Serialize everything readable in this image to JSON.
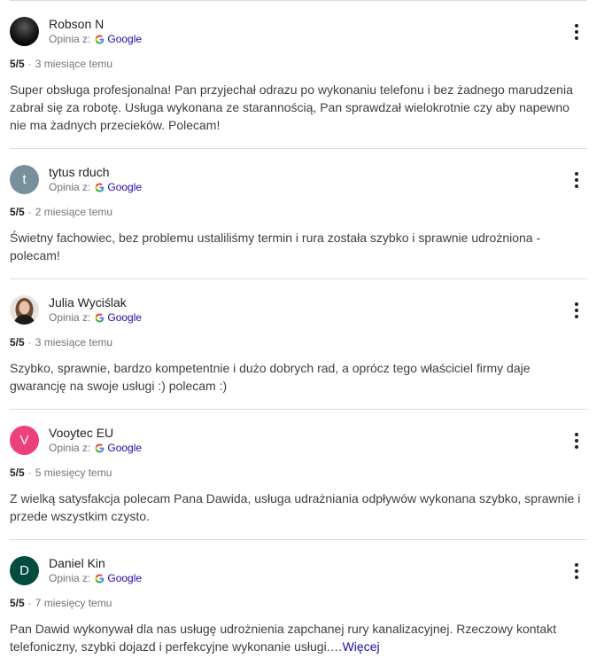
{
  "colors": {
    "google_link": "#1a0dab",
    "meta_gray": "#70757a",
    "divider": "#dadce0"
  },
  "reviews": [
    {
      "author": "Robson N",
      "avatar": {
        "type": "photo",
        "initial": "",
        "color": "#000000"
      },
      "source_prefix": "Opinia z:",
      "source_name": "Google",
      "score": "5/5",
      "separator": "·",
      "date": "3 miesiące temu",
      "text": "Super obsługa profesjonalna! Pan przyjechał odrazu po wykonaniu telefonu i bez żadnego marudzenia zabrał się za robotę. Usługa wykonana ze starannością, Pan sprawdzał wielokrotnie czy aby napewno nie ma żadnych przecieków. Polecam!",
      "more_label": ""
    },
    {
      "author": "tytus rduch",
      "avatar": {
        "type": "letter",
        "initial": "t",
        "color": "#78909c"
      },
      "source_prefix": "Opinia z:",
      "source_name": "Google",
      "score": "5/5",
      "separator": "·",
      "date": "2 miesiące temu",
      "text": "Świetny fachowiec, bez problemu ustaliliśmy termin i rura została szybko i sprawnie udrożniona - polecam!",
      "more_label": ""
    },
    {
      "author": "Julia Wyciślak",
      "avatar": {
        "type": "photo",
        "initial": "",
        "color": "#8d6e63"
      },
      "source_prefix": "Opinia z:",
      "source_name": "Google",
      "score": "5/5",
      "separator": "·",
      "date": "3 miesiące temu",
      "text": "Szybko, sprawnie, bardzo kompetentnie i dużo dobrych rad, a oprócz tego właściciel firmy daje gwarancję na swoje usługi :) polecam :)",
      "more_label": ""
    },
    {
      "author": "Vooytec EU",
      "avatar": {
        "type": "letter",
        "initial": "V",
        "color": "#ec407a"
      },
      "source_prefix": "Opinia z:",
      "source_name": "Google",
      "score": "5/5",
      "separator": "·",
      "date": "5 miesięcy temu",
      "text": "Z wielką satysfakcja polecam Pana Dawida, usługa udrażniania odpływów wykonana szybko, sprawnie i przede wszystkim czysto.",
      "more_label": ""
    },
    {
      "author": "Daniel Kin",
      "avatar": {
        "type": "letter",
        "initial": "D",
        "color": "#004d40"
      },
      "source_prefix": "Opinia z:",
      "source_name": "Google",
      "score": "5/5",
      "separator": "·",
      "date": "7 miesięcy temu",
      "text": "Pan Dawid wykonywał dla nas usługę udrożnienia zapchanej rury kanalizacyjnej. Rzeczowy kontakt telefoniczny, szybki dojazd i perfekcyjne wykonanie usługi.…",
      "more_label": "Więcej"
    }
  ]
}
